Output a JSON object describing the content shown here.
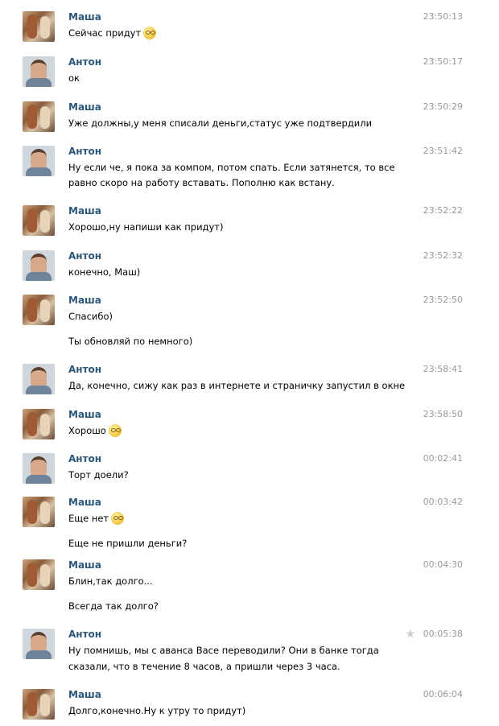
{
  "messages": [
    {
      "sender": "Маша",
      "avatar": "masha-avatar",
      "time": "23:50:13",
      "lines": [
        "Сейчас придут"
      ],
      "emoji": "confused-smiley-icon"
    },
    {
      "sender": "Антон",
      "avatar": "anton-avatar",
      "time": "23:50:17",
      "lines": [
        "ок"
      ]
    },
    {
      "sender": "Маша",
      "avatar": "masha-avatar",
      "time": "23:50:29",
      "lines": [
        "Уже должны,у меня списали деньги,статус уже подтвердили"
      ]
    },
    {
      "sender": "Антон",
      "avatar": "anton-avatar",
      "time": "23:51:42",
      "lines": [
        "Ну если че, я пока за компом, потом спать. Если затянется, то все",
        "равно скоро на работу вставать. Пополню как встану."
      ]
    },
    {
      "sender": "Маша",
      "avatar": "masha-avatar",
      "time": "23:52:22",
      "lines": [
        "Хорошо,ну напиши как придут)"
      ]
    },
    {
      "sender": "Антон",
      "avatar": "anton-avatar",
      "time": "23:52:32",
      "lines": [
        "конечно, Маш)"
      ]
    },
    {
      "sender": "Маша",
      "avatar": "masha-avatar",
      "time": "23:52:50",
      "lines": [
        "Спасибо)",
        "Ты обновляй по немного)"
      ]
    },
    {
      "sender": "Антон",
      "avatar": "anton-avatar",
      "time": "23:58:41",
      "lines": [
        "Да, конечно, сижу как раз в интернете и страничку запустил в окне"
      ]
    },
    {
      "sender": "Маша",
      "avatar": "masha-avatar",
      "time": "23:58:50",
      "lines": [
        "Хорошо"
      ],
      "emoji": "confused-smiley-icon"
    },
    {
      "sender": "Антон",
      "avatar": "anton-avatar",
      "time": "00:02:41",
      "lines": [
        "Торт доели?"
      ]
    },
    {
      "sender": "Маша",
      "avatar": "masha-avatar",
      "time": "00:03:42",
      "lines": [
        "Еще нет",
        "Еще не пришли деньги?"
      ],
      "emoji": "grin-smiley-icon"
    },
    {
      "sender": "Маша",
      "avatar": "masha-avatar",
      "time": "00:04:30",
      "lines": [
        "Блин,так долго...",
        "Всегда так долго?"
      ]
    },
    {
      "sender": "Антон",
      "avatar": "anton-avatar",
      "time": "00:05:38",
      "lines": [
        "Ну помнишь, мы с аванса Васе переводили? Они в банке тогда",
        "сказали, что в течение 8 часов, а пришли через 3 часа."
      ],
      "starred": "star-icon"
    },
    {
      "sender": "Маша",
      "avatar": "masha-avatar",
      "time": "00:06:04",
      "lines": [
        "Долго,конечно.Ну к утру то придут)"
      ]
    }
  ]
}
